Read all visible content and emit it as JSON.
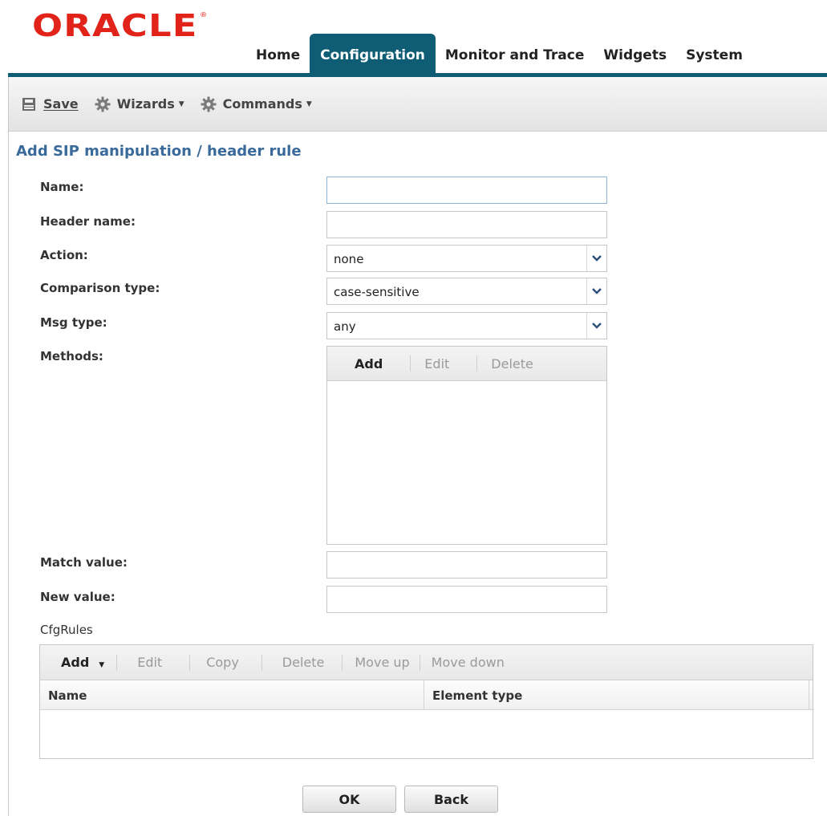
{
  "brand": {
    "logo_text": "ORACLE",
    "trademark": "®",
    "logo_color": "#e2231a"
  },
  "nav": {
    "tabs": [
      {
        "label": "Home",
        "active": false
      },
      {
        "label": "Configuration",
        "active": true
      },
      {
        "label": "Monitor and Trace",
        "active": false
      },
      {
        "label": "Widgets",
        "active": false
      },
      {
        "label": "System",
        "active": false
      }
    ],
    "accent": "#0f5d74"
  },
  "toolbar": {
    "save_label": "Save",
    "wizards_label": "Wizards",
    "commands_label": "Commands",
    "icons": [
      "save-icon",
      "gear-icon",
      "gear-icon"
    ]
  },
  "page": {
    "title": "Add SIP manipulation / header rule"
  },
  "form": {
    "name": {
      "label": "Name:",
      "value": ""
    },
    "header_name": {
      "label": "Header name:",
      "value": ""
    },
    "action": {
      "label": "Action:",
      "value": "none"
    },
    "comparison_type": {
      "label": "Comparison type:",
      "value": "case-sensitive"
    },
    "msg_type": {
      "label": "Msg type:",
      "value": "any"
    },
    "methods": {
      "label": "Methods:",
      "add_label": "Add",
      "edit_label": "Edit",
      "delete_label": "Delete"
    },
    "match_value": {
      "label": "Match value:",
      "value": ""
    },
    "new_value": {
      "label": "New value:",
      "value": ""
    }
  },
  "cfgrules": {
    "label": "CfgRules",
    "toolbar": {
      "add": "Add",
      "edit": "Edit",
      "copy": "Copy",
      "delete": "Delete",
      "move_up": "Move up",
      "move_down": "Move down"
    },
    "columns": [
      "Name",
      "Element type"
    ],
    "rows": []
  },
  "buttons": {
    "ok": "OK",
    "back": "Back"
  }
}
